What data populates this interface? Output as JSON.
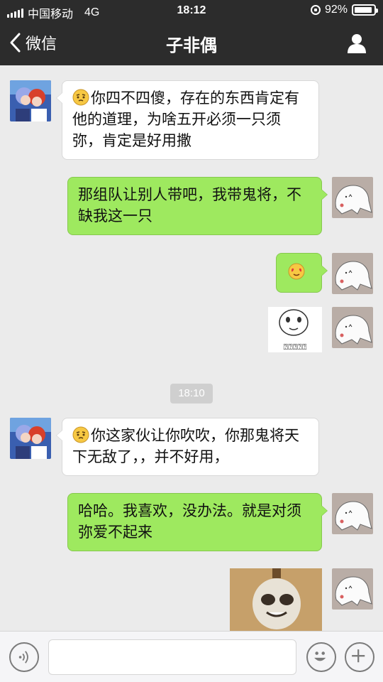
{
  "status_bar": {
    "carrier": "中国移动",
    "network": "4G",
    "time": "18:12",
    "battery": "92%",
    "battery_level": 0.92
  },
  "nav": {
    "back_label": "微信",
    "title": "子非偶"
  },
  "messages": [
    {
      "side": "left",
      "emoji": "thinking-face",
      "text": "你四不四傻，存在的东西肯定有他的道理，为啥五开必须一只须弥，肯定是好用撒"
    },
    {
      "side": "right",
      "text": "那组队让别人带吧，我带鬼将，不缺我这一只"
    },
    {
      "side": "right",
      "emoji": "heart-eyes-face",
      "text": ""
    },
    {
      "side": "right",
      "sticker": "panda-face-sticker",
      "sticker_caption": "⍰⍰⍰⍰⍰"
    },
    {
      "side": "left",
      "emoji": "thinking-face",
      "text": "你这家伙让你吹吹，你那鬼将天下无敌了，，并不好用，"
    },
    {
      "side": "right",
      "text": "哈哈。我喜欢，没办法。就是对须弥爱不起来"
    },
    {
      "side": "right",
      "sticker": "crying-panda-sticker"
    }
  ],
  "timestamp_divider": "18:10",
  "input_bar": {
    "voice_icon": "voice-icon",
    "emoji_icon": "smiley-icon",
    "plus_icon": "plus-icon",
    "placeholder": ""
  },
  "colors": {
    "nav_bg": "#2c2c2c",
    "chat_bg": "#ebebeb",
    "bubble_right": "#9ee95f",
    "bubble_left": "#ffffff"
  }
}
